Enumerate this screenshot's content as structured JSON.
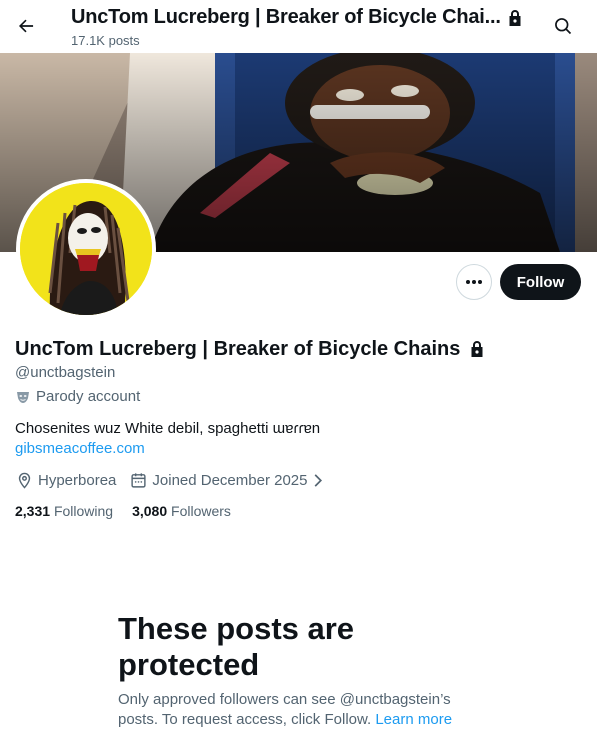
{
  "header": {
    "title": "UncTom Lucreberg | Breaker of Bicycle Chai...",
    "post_count": "17.1K posts"
  },
  "profile": {
    "display_name": "UncTom Lucreberg | Breaker of Bicycle Chains",
    "handle": "@unctbagstein",
    "account_label": "Parody account",
    "bio": "Chosenites wuz White debil, spaghetti ɯɐɾɾɐn",
    "website": "gibsmeacoffee.com",
    "location": "Hyperborea",
    "joined": "Joined December 2025",
    "following_count": "2,331",
    "following_label": "Following",
    "followers_count": "3,080",
    "followers_label": "Followers"
  },
  "actions": {
    "follow_label": "Follow"
  },
  "protected": {
    "title": "These posts are protected",
    "text": "Only approved followers can see @unctbagstein’s posts. To request access, click Follow.",
    "learn_more": "Learn more"
  },
  "colors": {
    "accent": "#1d9bf0",
    "text_primary": "#0f1419",
    "text_secondary": "#536471",
    "follow_button_bg": "#0f1419",
    "avatar_bg": "#f2e31a"
  },
  "icons": [
    "back-arrow-icon",
    "lock-icon",
    "search-icon",
    "more-icon",
    "parody-mask-icon",
    "location-pin-icon",
    "calendar-icon",
    "chevron-right-icon"
  ]
}
